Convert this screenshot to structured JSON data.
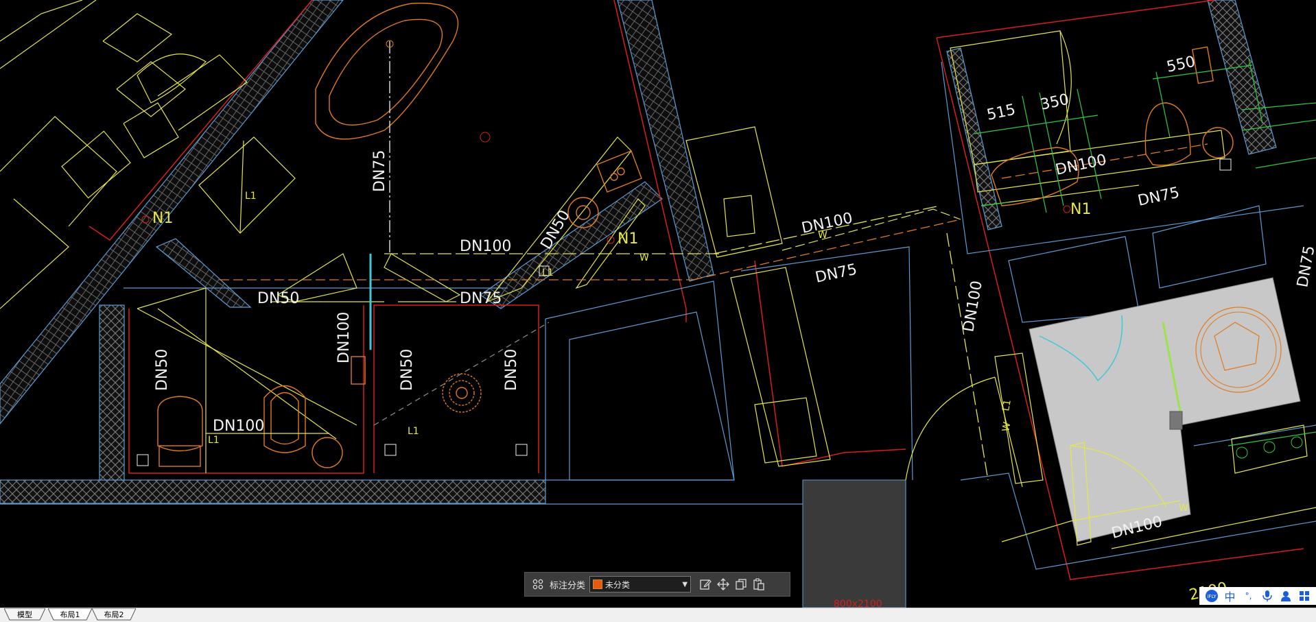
{
  "drawing": {
    "labels": {
      "dn75_vert_top": "DN75",
      "dn100_mid": "DN100",
      "dn50_slant": "DN50",
      "n1_a": "N1",
      "n1_b": "N1",
      "n1_c": "N1",
      "l1_a": "L1",
      "l1_b": "L1",
      "l1_c": "L1",
      "l1_d": "L1",
      "l1_e": "L1",
      "dn50_left": "DN50",
      "dn75_center": "DN75",
      "dn100_vert_center": "DN100",
      "dn50_vert_a": "DN50",
      "dn50_vert_b": "DN50",
      "dn50_vert_c": "DN50",
      "dn100_bottom": "DN100",
      "dn100_right_top": "DN100",
      "dn75_right": "DN75",
      "dn100_vert_right": "DN100",
      "dim_515": "515",
      "dim_350": "350",
      "dim_550": "550",
      "dn100_bath": "DN100",
      "dn75_bath": "DN75",
      "dn75_edge": "DN75",
      "dn100_grey": "DN100",
      "dim_2100": "2100",
      "dim_bottom": "800x2100",
      "w_a": "W",
      "w_b": "W",
      "w_c": "W",
      "w_d": "W"
    }
  },
  "annotation_toolbar": {
    "label": "标注分类",
    "category_value": "未分类",
    "category_color": "#e8590c",
    "icons": [
      "grid-icon",
      "edit-icon",
      "move-icon",
      "copy-icon",
      "paste-icon"
    ]
  },
  "tabs": [
    {
      "label": "模型",
      "active": false
    },
    {
      "label": "布局1",
      "active": true
    },
    {
      "label": "布局2",
      "active": false
    }
  ],
  "ime": {
    "chinese": "中",
    "punct": "°,",
    "icons": [
      "ime-logo-icon",
      "microphone-icon",
      "user-icon",
      "apps-grid-icon"
    ]
  },
  "colors": {
    "background": "#000000",
    "wall_red": "#d81e1e",
    "wall_blue": "#5b9bd5",
    "fixture_yellow": "#e6e64a",
    "fixture_orange": "#e07a1f",
    "dim_green": "#2ecc40",
    "text_white": "#f2f2f2"
  }
}
